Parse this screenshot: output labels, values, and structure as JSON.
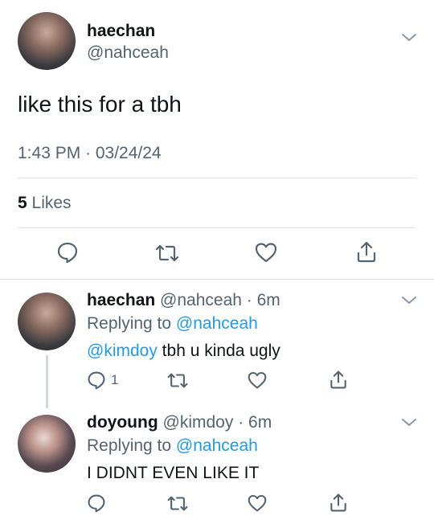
{
  "tweet": {
    "author_name": "haechan",
    "author_handle": "@nahceah",
    "text": "like this for a tbh",
    "timestamp": "1:43 PM · 03/24/24",
    "likes_count": "5",
    "likes_label": "Likes"
  },
  "replies": [
    {
      "author_name": "haechan",
      "author_handle": "@nahceah",
      "age": "· 6m",
      "replying_prefix": "Replying to",
      "replying_to": "@nahceah",
      "mention": "@kimdoy",
      "text": " tbh u kinda ugly",
      "reply_count": "1"
    },
    {
      "author_name": "doyoung",
      "author_handle": "@kimdoy",
      "age": "· 6m",
      "replying_prefix": "Replying to",
      "replying_to": "@nahceah",
      "text": "I DIDNT EVEN LIKE IT"
    }
  ],
  "icons": {
    "reply": "speech-bubble-icon",
    "retweet": "retweet-arrows-icon",
    "like": "heart-icon",
    "share": "share-upload-icon",
    "menu": "chevron-down-icon"
  },
  "colors": {
    "text": "#0f1419",
    "secondary": "#536471",
    "link": "#1d9bf0",
    "divider": "#e1e6ea"
  }
}
